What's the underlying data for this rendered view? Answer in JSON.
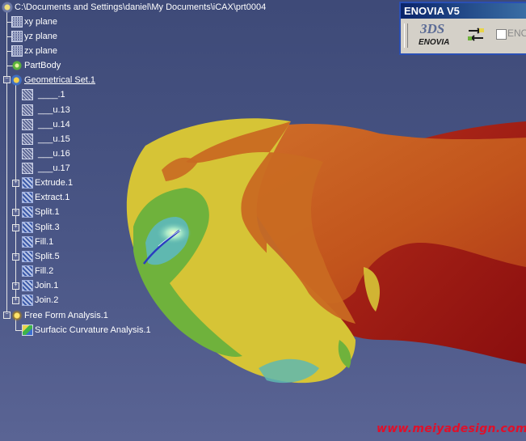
{
  "spec_tree": {
    "root": "C:\\Documents and Settings\\daniel\\My Documents\\iCAX\\prt0004",
    "items": [
      {
        "label": "xy plane",
        "icon": "plane-icon"
      },
      {
        "label": "yz plane",
        "icon": "plane-icon"
      },
      {
        "label": "zx plane",
        "icon": "plane-icon"
      },
      {
        "label": "PartBody",
        "icon": "partbody-icon"
      },
      {
        "label": "Geometrical Set.1",
        "icon": "geometrical-set-icon"
      },
      {
        "label": "____.1",
        "icon": "surface-icon"
      },
      {
        "label": "___u.13",
        "icon": "surface-icon"
      },
      {
        "label": "___u.14",
        "icon": "surface-icon"
      },
      {
        "label": "___u.15",
        "icon": "surface-icon"
      },
      {
        "label": "___u.16",
        "icon": "surface-icon"
      },
      {
        "label": "___u.17",
        "icon": "surface-icon"
      },
      {
        "label": "Extrude.1",
        "icon": "extrude-icon"
      },
      {
        "label": "Extract.1",
        "icon": "extract-icon"
      },
      {
        "label": "Split.1",
        "icon": "split-icon"
      },
      {
        "label": "Split.3",
        "icon": "split-icon"
      },
      {
        "label": "Fill.1",
        "icon": "fill-icon"
      },
      {
        "label": "Split.5",
        "icon": "split-icon"
      },
      {
        "label": "Fill.2",
        "icon": "fill-icon"
      },
      {
        "label": "Join.1",
        "icon": "join-icon"
      },
      {
        "label": "Join.2",
        "icon": "join-icon"
      },
      {
        "label": "Free Form Analysis.1",
        "icon": "free-form-analysis-icon"
      },
      {
        "label": "Surfacic Curvature Analysis.1",
        "icon": "curvature-analysis-icon"
      }
    ]
  },
  "enovia_toolbar": {
    "title": "ENOVIA V5",
    "logo_mark": "3DS",
    "logo_text": "ENOVIA",
    "checkbox_label": "ENO"
  },
  "watermark": "www.meiyadesign.com",
  "colors": {
    "viewport_background": "#4a5686",
    "tree_text": "#ffffff",
    "watermark": "#e0102a",
    "curvature_red": "#c8261e",
    "curvature_orange": "#c8621e",
    "curvature_yellow": "#d8c832",
    "curvature_green": "#6fb23c",
    "curvature_cyan": "#5fb8b0",
    "curvature_blue": "#3c50c8"
  }
}
